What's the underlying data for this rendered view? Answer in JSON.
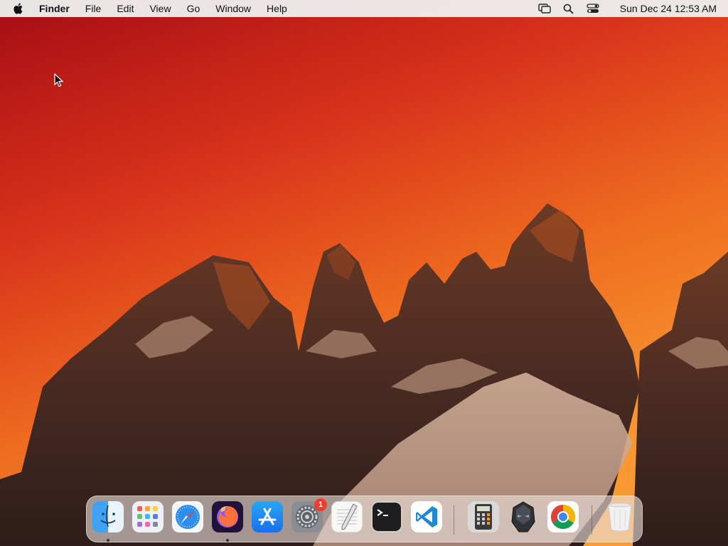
{
  "menubar": {
    "app_name": "Finder",
    "menus": [
      "File",
      "Edit",
      "View",
      "Go",
      "Window",
      "Help"
    ],
    "datetime": "Sun Dec 24  12:53 AM"
  },
  "dock": {
    "apps": [
      {
        "name": "Finder",
        "icon": "finder-icon",
        "running": true
      },
      {
        "name": "Launchpad",
        "icon": "launchpad-icon",
        "running": false
      },
      {
        "name": "Safari",
        "icon": "safari-icon",
        "running": false
      },
      {
        "name": "Firefox",
        "icon": "firefox-icon",
        "running": true
      },
      {
        "name": "App Store",
        "icon": "app-store-icon",
        "running": false
      },
      {
        "name": "System Settings",
        "icon": "settings-gear-icon",
        "running": false,
        "badge": "1"
      },
      {
        "name": "TextEdit",
        "icon": "textedit-icon",
        "running": false
      },
      {
        "name": "Terminal",
        "icon": "terminal-icon",
        "running": false
      },
      {
        "name": "Visual Studio Code",
        "icon": "vscode-icon",
        "running": false
      },
      {
        "name": "Calculator",
        "icon": "calculator-icon",
        "running": false
      },
      {
        "name": "Helmet App",
        "icon": "helmet-icon",
        "running": false
      },
      {
        "name": "Google Chrome",
        "icon": "chrome-icon",
        "running": false
      },
      {
        "name": "Trash",
        "icon": "trash-icon",
        "running": false
      }
    ]
  },
  "colors": {
    "sky_top": "#a50c14",
    "sky_bottom": "#f9a03a",
    "menubar_bg": "#ececec"
  }
}
